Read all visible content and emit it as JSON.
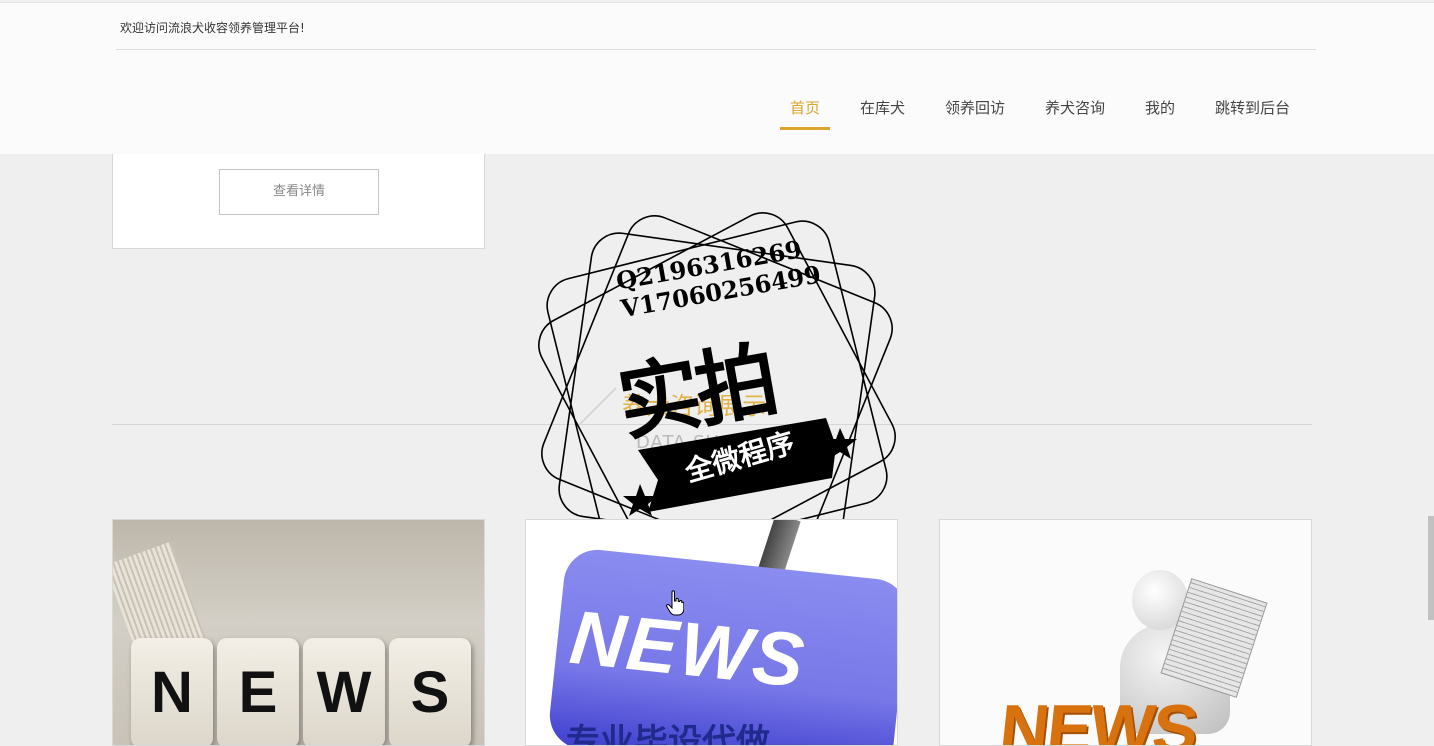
{
  "header": {
    "welcome": "欢迎访问流浪犬收容领养管理平台!",
    "nav": [
      {
        "label": "首页",
        "active": true
      },
      {
        "label": "在库犬",
        "active": false
      },
      {
        "label": "领养回访",
        "active": false
      },
      {
        "label": "养犬咨询",
        "active": false
      },
      {
        "label": "我的",
        "active": false
      },
      {
        "label": "跳转到后台",
        "active": false
      }
    ]
  },
  "card_top": {
    "detail_label": "查看详情"
  },
  "section": {
    "title": "养犬咨询展示",
    "subtitle": "DATA SHOW"
  },
  "stamp": {
    "line1": "Q2196316269",
    "line2": "V17060256499",
    "big": "实拍",
    "banner": "全微程序"
  },
  "news_cards": [
    {
      "image_text": "NEWS",
      "letters": [
        "N",
        "E",
        "W",
        "S"
      ]
    },
    {
      "image_text": "NEWS",
      "bottom_text": "专业毕设代做"
    },
    {
      "image_text": "NEWS"
    }
  ],
  "colors": {
    "accent": "#d9a52a",
    "background": "#eeefee",
    "header": "#fafbfa"
  }
}
